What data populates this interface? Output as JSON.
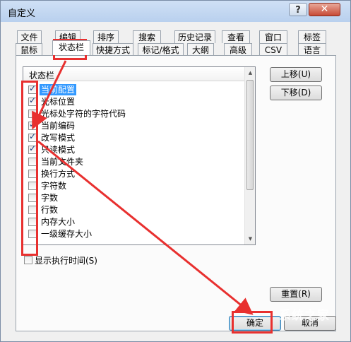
{
  "window": {
    "title": "自定义",
    "help_glyph": "?",
    "close_glyph": "✕"
  },
  "tabs_row1": [
    "文件",
    "编辑",
    "排序",
    "搜索",
    "历史记录",
    "查看",
    "窗口",
    "标签"
  ],
  "tabs_row2": [
    "鼠标",
    "状态栏",
    "快捷方式",
    "标记/格式",
    "大纲",
    "高级",
    "CSV",
    "语言"
  ],
  "active_tab": "状态栏",
  "list": {
    "header": "状态栏",
    "items": [
      {
        "label": "当前配置",
        "checked": true,
        "selected": true
      },
      {
        "label": "光标位置",
        "checked": true,
        "selected": false
      },
      {
        "label": "光标处字符的字符代码",
        "checked": false,
        "selected": false
      },
      {
        "label": "当前编码",
        "checked": true,
        "selected": false
      },
      {
        "label": "改写模式",
        "checked": true,
        "selected": false
      },
      {
        "label": "只读模式",
        "checked": true,
        "selected": false
      },
      {
        "label": "当前文件夹",
        "checked": false,
        "selected": false
      },
      {
        "label": "换行方式",
        "checked": false,
        "selected": false
      },
      {
        "label": "字符数",
        "checked": false,
        "selected": false
      },
      {
        "label": "字数",
        "checked": false,
        "selected": false
      },
      {
        "label": "行数",
        "checked": false,
        "selected": false
      },
      {
        "label": "内存大小",
        "checked": false,
        "selected": false
      },
      {
        "label": "一级缓存大小",
        "checked": false,
        "selected": false
      }
    ]
  },
  "buttons": {
    "move_up": "上移(U)",
    "move_down": "下移(D)",
    "reset": "重置(R)",
    "ok": "确定",
    "cancel": "取消"
  },
  "show_exec_time": {
    "label": "显示执行时间(S)",
    "checked": false
  },
  "annotation_color": "#e8302f",
  "watermark": "系统之家"
}
